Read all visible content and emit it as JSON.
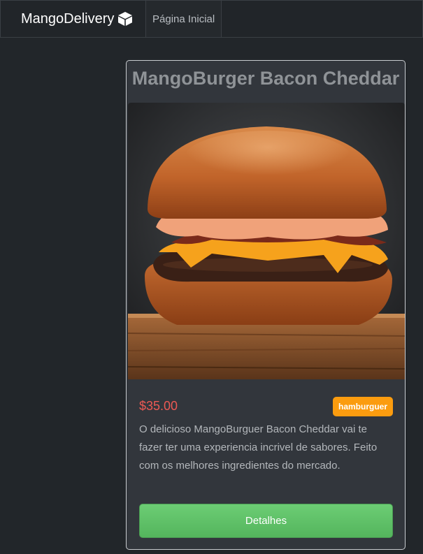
{
  "navbar": {
    "brand": "MangoDelivery",
    "links": [
      {
        "label": "Página Inicial"
      }
    ]
  },
  "product": {
    "title": "MangoBurger Bacon Cheddar",
    "image_alt": "burger-photo",
    "price": "$35.00",
    "category": "hamburguer",
    "description": "O delicioso MangoBurguer Bacon Cheddar vai te fazer ter uma experiencia incrivel de sabores. Feito com os melhores ingredientes do mercado.",
    "details_button": "Detalhes"
  },
  "colors": {
    "price": "#ec5a54",
    "badge": "#fb9c0f",
    "button": "#5cbf65"
  }
}
